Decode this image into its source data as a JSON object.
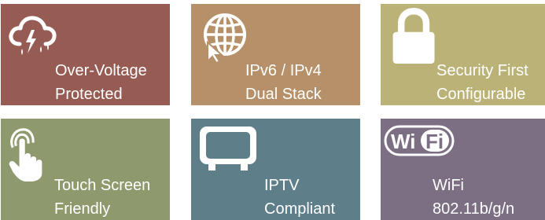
{
  "tiles": [
    {
      "id": "over-voltage",
      "icon": "storm-cloud-icon",
      "color": "#965c54",
      "line1": "Over-Voltage",
      "line2": "Protected"
    },
    {
      "id": "ipv6",
      "icon": "globe-cursor-icon",
      "color": "#b69068",
      "line1": "IPv6 / IPv4",
      "line2": "Dual Stack"
    },
    {
      "id": "security",
      "icon": "padlock-icon",
      "color": "#bab277",
      "line1": "Security First",
      "line2": "Configurable"
    },
    {
      "id": "touch",
      "icon": "touch-hand-icon",
      "color": "#8e9a6e",
      "line1": "Touch Screen",
      "line2": "Friendly"
    },
    {
      "id": "iptv",
      "icon": "tv-icon",
      "color": "#5e7e89",
      "line1": "IPTV",
      "line2": "Compliant"
    },
    {
      "id": "wifi",
      "icon": "wifi-logo-icon",
      "color": "#7c6f84",
      "logo_text": "WiFi",
      "line1": "WiFi",
      "line2": "802.11b/g/n"
    }
  ]
}
